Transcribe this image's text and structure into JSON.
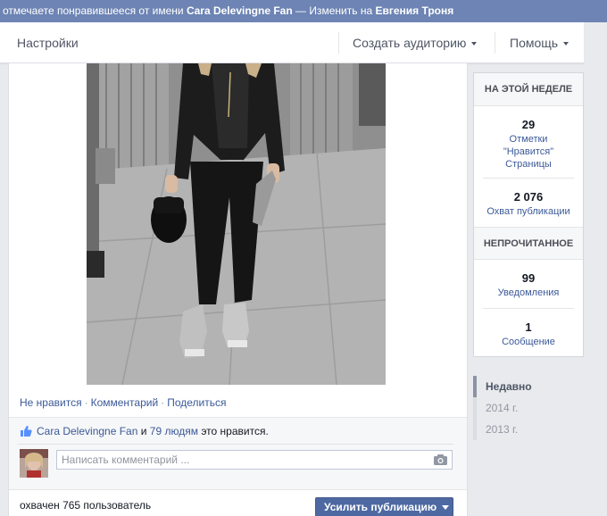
{
  "notice": {
    "prefix": "отмечаете понравившееся от имени",
    "page_name": "Cara Delevingne Fan",
    "suffix": "— Изменить на",
    "alt_name": "Евгения Троня"
  },
  "pagebar": {
    "settings": "Настройки",
    "create_audience": "Создать аудиторию",
    "help": "Помощь"
  },
  "post": {
    "actions": {
      "unlike": "Не нравится",
      "comment": "Комментарий",
      "share": "Поделиться",
      "dot": "·"
    },
    "likes": {
      "page_name": "Cara Delevingne Fan",
      "and": "и",
      "people": "79 людям",
      "tail": "это нравится."
    },
    "comment_placeholder": "Написать комментарий ...",
    "reach": "охвачен 765 пользователь",
    "boost_label": "Усилить публикацию"
  },
  "sidebar": {
    "this_week": "НА ЭТОЙ НЕДЕЛЕ",
    "likes_count": "29",
    "likes_label_1": "Отметки",
    "likes_label_2": "\"Нравится\"",
    "likes_label_3": "Страницы",
    "reach_count": "2 076",
    "reach_label": "Охват публикации",
    "unread": "НЕПРОЧИТАННОЕ",
    "notifications_count": "99",
    "notifications_label": "Уведомления",
    "messages_count": "1",
    "messages_label": "Сообщение"
  },
  "timeline": {
    "recent": "Недавно",
    "y2014": "2014 г.",
    "y2013": "2013 г."
  },
  "colors": {
    "notice_bar": "#6d84b4",
    "link": "#3b5998",
    "boost_button": "#4e69a2"
  },
  "icons": [
    "thumbs-up-icon",
    "camera-icon",
    "caret-down-icon"
  ]
}
